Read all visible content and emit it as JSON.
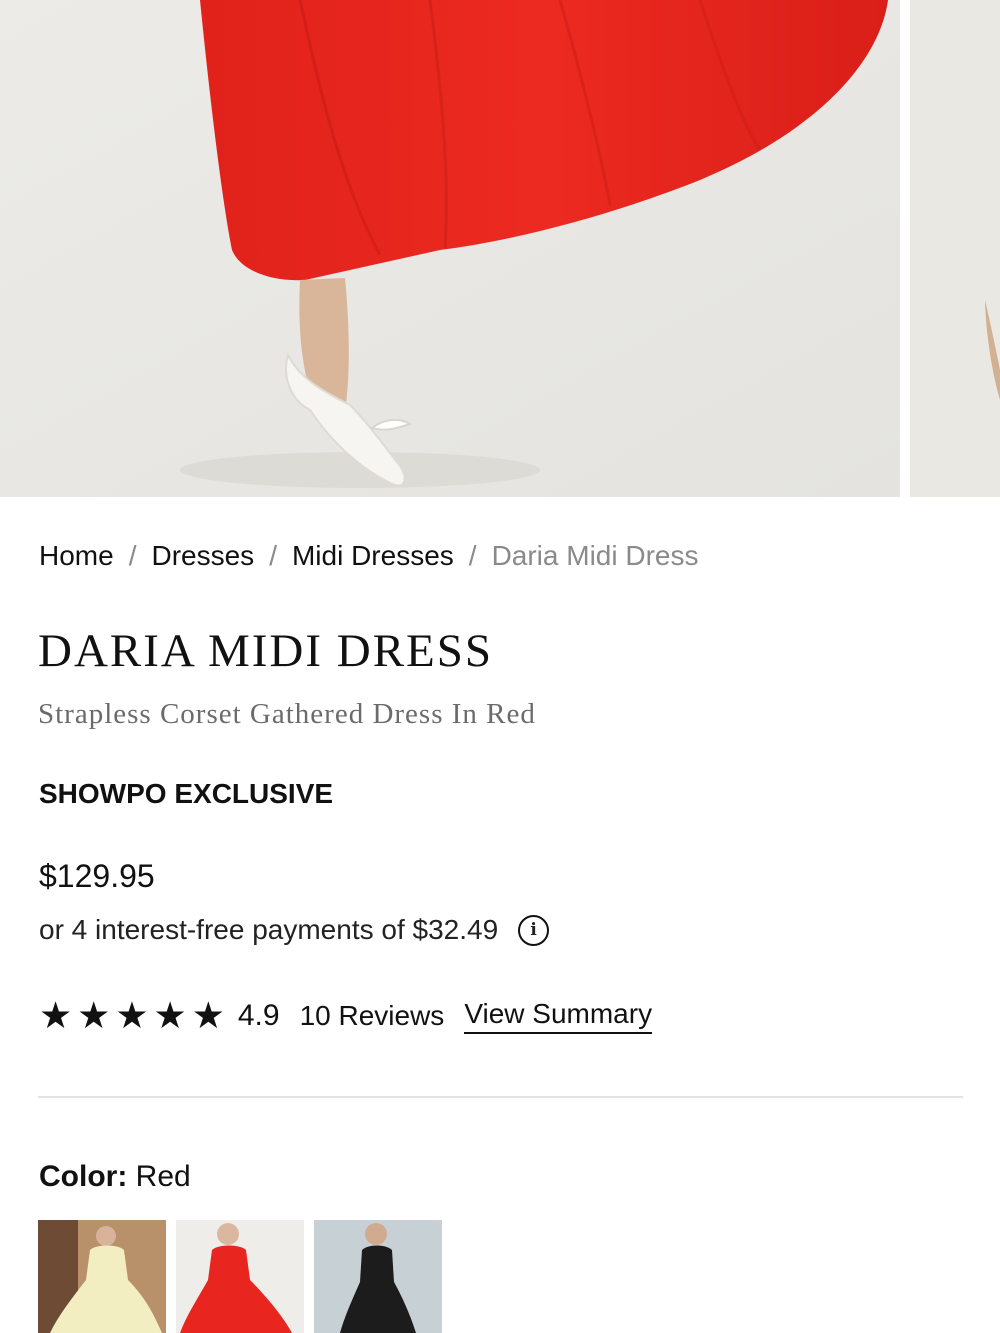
{
  "gallery": {
    "images": [
      {
        "alt": "model-red-dress-skirt-and-shoes"
      },
      {
        "alt": "next-image-peek"
      }
    ]
  },
  "breadcrumb": {
    "items": [
      "Home",
      "Dresses",
      "Midi Dresses"
    ],
    "current": "Daria Midi Dress",
    "separator": "/"
  },
  "product": {
    "title": "DARIA MIDI DRESS",
    "subtitle": "Strapless Corset Gathered Dress In Red",
    "badge": "SHOWPO EXCLUSIVE",
    "price": "$129.95",
    "payments_prefix": "or 4 interest-free payments of",
    "payment_amount": "$32.49",
    "info_icon": "i"
  },
  "rating": {
    "stars": 5,
    "star_glyph": "★",
    "score": "4.9",
    "reviews": "10 Reviews",
    "summary_link": "View Summary"
  },
  "color": {
    "label": "Color:",
    "value": "Red",
    "swatches": [
      {
        "name": "Lemon",
        "color": "#f2ecbf"
      },
      {
        "name": "Red",
        "color": "#e8251f"
      },
      {
        "name": "Black",
        "color": "#1c1c1c"
      }
    ]
  },
  "colors": {
    "dress_red": "#e8271e",
    "text": "#111111",
    "muted": "#8a8a8a",
    "divider": "#e3e3e3"
  }
}
